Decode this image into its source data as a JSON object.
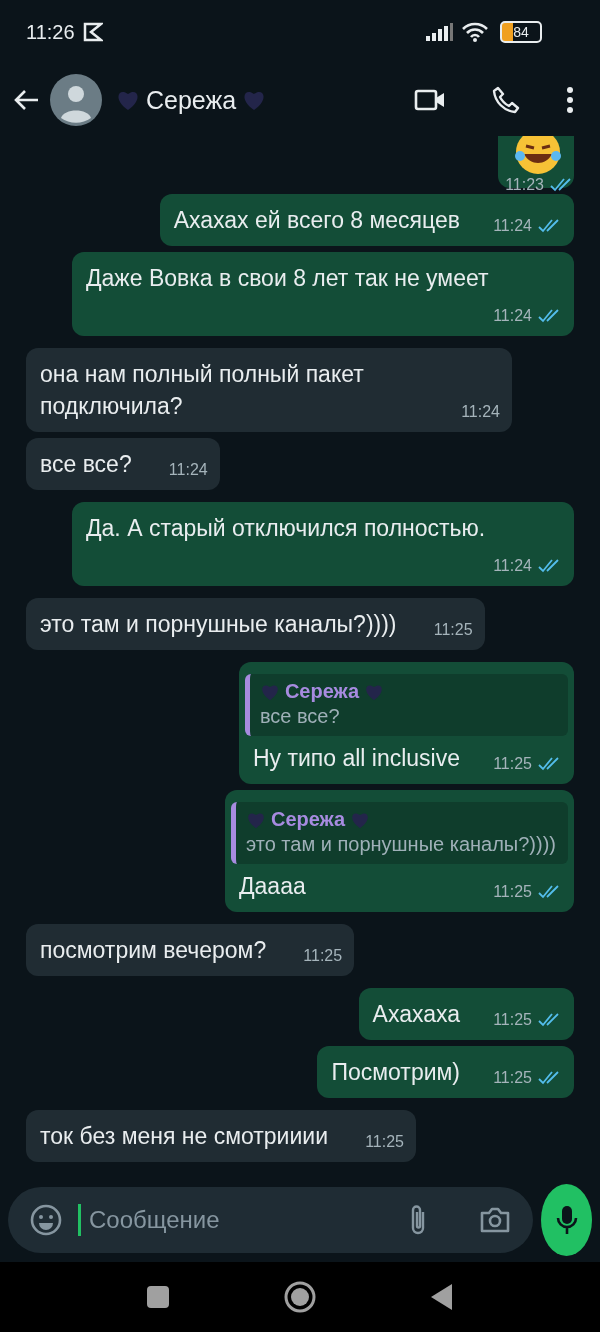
{
  "status_bar": {
    "time": "11:26",
    "battery": "84"
  },
  "header": {
    "contact": "Сережа"
  },
  "messages": [
    {
      "kind": "emoji",
      "out": true,
      "time": "11:23",
      "read": true
    },
    {
      "kind": "text",
      "out": true,
      "text": "Ахахах ей всего 8 месяцев",
      "time": "11:24",
      "read": true
    },
    {
      "kind": "text",
      "out": true,
      "text": "Даже Вовка в свои 8 лет так не умеет",
      "time": "11:24",
      "read": true
    },
    {
      "kind": "text",
      "out": false,
      "text": "она нам полный полный пакет подключила?",
      "time": "11:24"
    },
    {
      "kind": "text",
      "out": false,
      "text": "все все?",
      "time": "11:24"
    },
    {
      "kind": "text",
      "out": true,
      "text": "Да. А старый отключился полностью.",
      "time": "11:24",
      "read": true
    },
    {
      "kind": "text",
      "out": false,
      "text": "это там и порнушные каналы?))))",
      "time": "11:25"
    },
    {
      "kind": "reply",
      "out": true,
      "quote": {
        "author": "Сережа",
        "text": "все все?"
      },
      "text": "Ну типо all inclusive",
      "time": "11:25",
      "read": true
    },
    {
      "kind": "reply",
      "out": true,
      "quote": {
        "author": "Сережа",
        "text": "это там и порнушные каналы?))))"
      },
      "text": "Даааа",
      "time": "11:25",
      "read": true
    },
    {
      "kind": "text",
      "out": false,
      "text": "посмотрим вечером?",
      "time": "11:25"
    },
    {
      "kind": "text",
      "out": true,
      "text": "Ахахаха",
      "time": "11:25",
      "read": true
    },
    {
      "kind": "text",
      "out": true,
      "text": "Посмотрим)",
      "time": "11:25",
      "read": true
    },
    {
      "kind": "text",
      "out": false,
      "text": "ток без меня не смотрииии",
      "time": "11:25"
    }
  ],
  "composer": {
    "placeholder": "Сообщение"
  }
}
